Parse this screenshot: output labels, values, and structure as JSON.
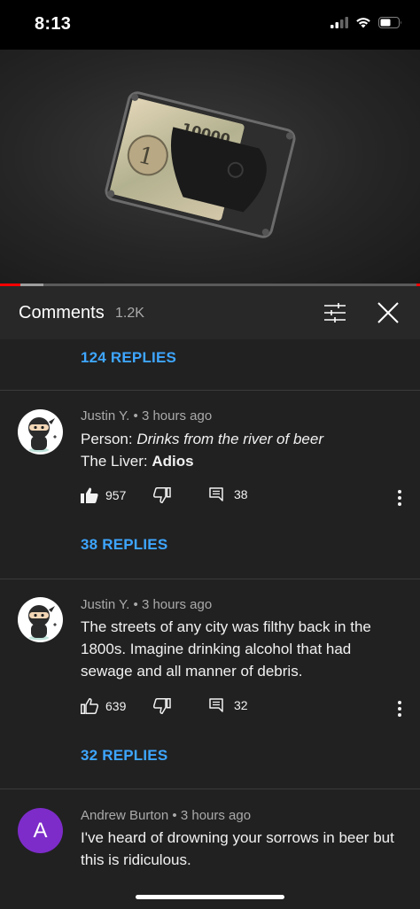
{
  "status": {
    "time": "8:13"
  },
  "header": {
    "title": "Comments",
    "count": "1.2K"
  },
  "top_replies": {
    "label": "124 REPLIES"
  },
  "comments": [
    {
      "author": "Justin Y.",
      "time": "3 hours ago",
      "line1_prefix": "Person: ",
      "line1_italic": "Drinks from the river of beer",
      "line2_prefix": "The Liver: ",
      "line2_bold": "Adios",
      "likes": "957",
      "replies_count": "38",
      "replies_label": "38 REPLIES"
    },
    {
      "author": "Justin Y.",
      "time": "3 hours ago",
      "text": "The streets of any city was filthy back in the 1800s. Imagine drinking alcohol that had sewage and all manner of debris.",
      "likes": "639",
      "replies_count": "32",
      "replies_label": "32 REPLIES"
    },
    {
      "author": "Andrew Burton",
      "time": "3 hours ago",
      "avatar_letter": "A",
      "text": "I've heard of drowning your sorrows in beer but this is ridiculous."
    }
  ],
  "separator": "•",
  "colors": {
    "link": "#3ea6ff",
    "progress": "#ff0000",
    "avatar_a": "#7d2cc9",
    "background": "#212121",
    "header": "#282828"
  },
  "icons": [
    "signal-icon",
    "wifi-icon",
    "battery-icon",
    "filter-icon",
    "close-icon",
    "thumb-up-icon",
    "thumb-down-icon",
    "reply-icon",
    "more-vert-icon"
  ]
}
